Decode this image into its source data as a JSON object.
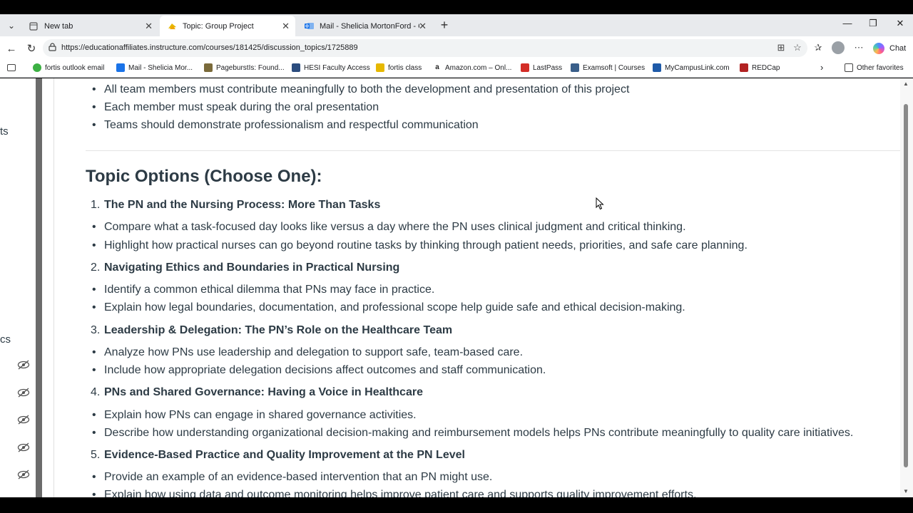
{
  "tabs": [
    {
      "label": "New tab",
      "icon": "page-icon"
    },
    {
      "label": "Topic: Group Project",
      "icon": "canvas-icon"
    },
    {
      "label": "Mail - Shelicia MortonFord - Outlook",
      "icon": "outlook-icon"
    }
  ],
  "address": {
    "url": "https://educationaffiliates.instructure.com/courses/181425/discussion_topics/1725889"
  },
  "chat_label": "Chat",
  "bookmarks": [
    {
      "label": "fortis outlook email",
      "color": "#3cb043"
    },
    {
      "label": "Mail - Shelicia Mor...",
      "color": "#1a73e8"
    },
    {
      "label": "PageburstIs: Found...",
      "color": "#7a6a3a"
    },
    {
      "label": "HESI Faculty Access",
      "color": "#2b4c7e"
    },
    {
      "label": "fortis class",
      "color": "#e6b800"
    },
    {
      "label": "Amazon.com – Onl...",
      "color": "#222222"
    },
    {
      "label": "LastPass",
      "color": "#d32d27"
    },
    {
      "label": "Examsoft | Courses",
      "color": "#3a5f8a"
    },
    {
      "label": "MyCampusLink.com",
      "color": "#1e5aa8"
    },
    {
      "label": "REDCap",
      "color": "#b22222"
    }
  ],
  "other_favorites": "Other favorites",
  "left_nav": {
    "frag1": "ts",
    "frag2": "cs"
  },
  "content": {
    "intro_bullets": [
      "All team members must contribute meaningfully to both the development and presentation of this project",
      "Each member must speak during the oral presentation",
      "Teams should demonstrate professionalism and respectful communication"
    ],
    "heading": "Topic Options (Choose One):",
    "topics": [
      {
        "num": "1.",
        "title": "The PN and the Nursing Process: More Than Tasks",
        "bullets": [
          "Compare what a task-focused day looks like versus a day where the PN uses clinical judgment and critical thinking.",
          "Highlight how practical nurses can go beyond routine tasks by thinking through patient needs, priorities, and safe care planning."
        ]
      },
      {
        "num": "2.",
        "title": "Navigating Ethics and Boundaries in Practical Nursing",
        "bullets": [
          "Identify a common ethical dilemma that PNs may face in practice.",
          "Explain how legal boundaries, documentation, and professional scope help guide safe and ethical decision-making."
        ]
      },
      {
        "num": "3.",
        "title": "Leadership & Delegation: The PN’s Role on the Healthcare Team",
        "bullets": [
          "Analyze how PNs use leadership and delegation to support safe, team-based care.",
          "Include how appropriate delegation decisions affect outcomes and staff communication."
        ]
      },
      {
        "num": "4.",
        "title": "PNs and Shared Governance: Having a Voice in Healthcare",
        "bullets": [
          "Explain how PNs can engage in shared governance activities.",
          "Describe how understanding organizational decision-making and reimbursement models helps PNs contribute meaningfully to quality care initiatives."
        ]
      },
      {
        "num": "5.",
        "title": "Evidence-Based Practice and Quality Improvement at the PN Level",
        "bullets": [
          "Provide an example of an evidence-based intervention that an PN might use.",
          "Explain how using data and outcome monitoring helps improve patient care and supports quality improvement efforts."
        ]
      }
    ]
  }
}
